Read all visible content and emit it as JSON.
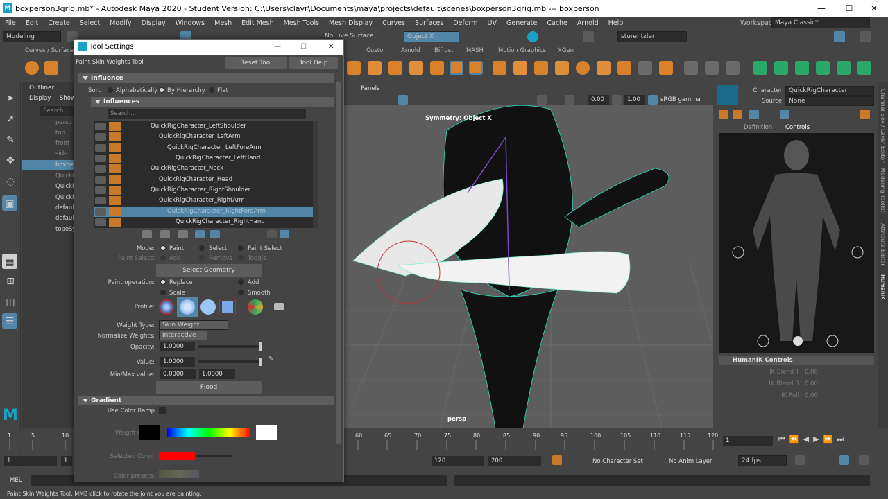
{
  "window": {
    "title": "boxperson3qrig.mb* - Autodesk Maya 2020 - Student Version: C:\\Users\\clayr\\Documents\\maya\\projects\\default\\scenes\\boxperson3qrig.mb   ---   boxperson",
    "min": "—",
    "max": "☐",
    "close": "✕"
  },
  "menu": [
    "File",
    "Edit",
    "Create",
    "Select",
    "Modify",
    "Display",
    "Windows",
    "Mesh",
    "Edit Mesh",
    "Mesh Tools",
    "Mesh Display",
    "Curves",
    "Surfaces",
    "Deform",
    "UV",
    "Generate",
    "Cache",
    "Arnold",
    "Help"
  ],
  "workspace": {
    "label": "Workspace :",
    "value": "Maya Classic*"
  },
  "status": {
    "mode": "Modeling",
    "live": "No Live Surface",
    "symmetry": "Object X",
    "user": "sturentzler"
  },
  "shelf_tabs": [
    "Curves / Surfaces",
    "Custom",
    "Arnold",
    "Bifrost",
    "MASH",
    "Motion Graphics",
    "XGen"
  ],
  "outliner": {
    "title": "Outliner",
    "menus": [
      "Display",
      "Show"
    ],
    "search": "Search...",
    "items": [
      "persp",
      "top",
      "front",
      "side",
      "boxper",
      "QuickR",
      "QuickF",
      "QuickF",
      "default",
      "default",
      "topoSy"
    ]
  },
  "tool_settings": {
    "title": "Tool Settings",
    "tool_name": "Paint Skin Weights Tool",
    "reset": "Reset Tool",
    "help": "Tool Help",
    "influence_header": "Influence",
    "sort_label": "Sort:",
    "sort_options": [
      "Alphabetically",
      "By Hierarchy",
      "Flat"
    ],
    "influences_header": "Influences",
    "search_placeholder": "Search...",
    "influences": [
      "QuickRigCharacter_LeftShoulder",
      "QuickRigCharacter_LeftArm",
      "QuickRigCharacter_LeftForeArm",
      "QuickRigCharacter_LeftHand",
      "QuickRigCharacter_Neck",
      "QuickRigCharacter_Head",
      "QuickRigCharacter_RightShoulder",
      "QuickRigCharacter_RightArm",
      "QuickRigCharacter_RightForeArm",
      "QuickRigCharacter_RightHand"
    ],
    "mode_label": "Mode:",
    "mode_options": [
      "Paint",
      "Select",
      "Paint Select"
    ],
    "paint_select_label": "Paint Select:",
    "paint_select_options": [
      "Add",
      "Remove",
      "Toggle"
    ],
    "select_geometry": "Select Geometry",
    "paint_op_label": "Paint operation:",
    "paint_ops": [
      "Replace",
      "Add",
      "Scale",
      "Smooth"
    ],
    "profile_label": "Profile:",
    "weight_type_label": "Weight Type:",
    "weight_type": "Skin Weight",
    "normalize_label": "Normalize Weights:",
    "normalize": "Interactive",
    "opacity_label": "Opacity:",
    "opacity": "1.0000",
    "value_label": "Value:",
    "value": "1.0000",
    "minmax_label": "Min/Max value:",
    "min": "0.0000",
    "max": "1.0000",
    "flood": "Flood",
    "gradient_header": "Gradient",
    "use_ramp": "Use Color Ramp",
    "weight_color": "Weight Color:",
    "selected_color": "Selected Color:",
    "color_presets": "Color presets:"
  },
  "viewport": {
    "menu": "Panels",
    "symmetry": "Symmetry: Object X",
    "camera": "persp",
    "exposure": "0.00",
    "gamma_val": "1.00",
    "colorspace": "sRGB gamma"
  },
  "hik": {
    "character_label": "Character:",
    "character": "QuickRigCharacter",
    "source_label": "Source:",
    "source": "None",
    "tabs": [
      "Definition",
      "Controls"
    ],
    "controls_header": "HumanIK Controls",
    "blend_t": "IK Blend T",
    "blend_r": "IK Blend R",
    "pull": "IK Pull",
    "val": "0.00"
  },
  "side_tabs": [
    "Channel Box / Layer Editor",
    "Modeling Toolkit",
    "Attribute Editor",
    "HumanIK"
  ],
  "timeline": {
    "ticks": [
      "1",
      "5",
      "10",
      "60",
      "65",
      "70",
      "75",
      "80",
      "85",
      "90",
      "95",
      "100",
      "105",
      "110",
      "115",
      "120"
    ],
    "current": "1"
  },
  "range": {
    "start": "1",
    "start2": "1",
    "end": "120",
    "end2": "200",
    "char_set": "No Character Set",
    "anim_layer": "No Anim Layer",
    "fps": "24 fps"
  },
  "mel": {
    "label": "MEL"
  },
  "help_line": "Paint Skin Weights Tool: MMB click to rotate the joint you are painting.",
  "colors": {
    "accent": "#5285a6",
    "influence_swatch": "#c87a2a",
    "selected_color": "#ff0000",
    "brand": "#1ba1c6"
  }
}
